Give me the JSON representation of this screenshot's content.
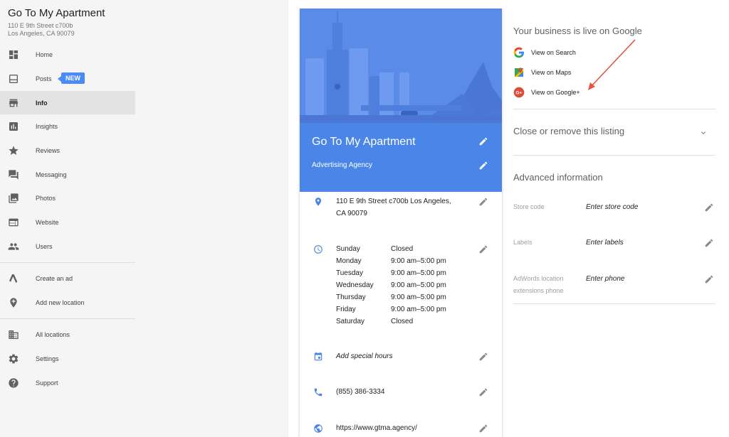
{
  "business": {
    "name": "Go To My Apartment",
    "address_line1": "110 E 9th Street c700b",
    "address_line2": "Los Angeles, CA 90079"
  },
  "sidebar": {
    "items": [
      {
        "label": "Home",
        "icon": "dashboard-icon"
      },
      {
        "label": "Posts",
        "icon": "posts-icon",
        "badge": "NEW"
      },
      {
        "label": "Info",
        "icon": "store-icon"
      },
      {
        "label": "Insights",
        "icon": "insights-icon"
      },
      {
        "label": "Reviews",
        "icon": "star-icon"
      },
      {
        "label": "Messaging",
        "icon": "chat-icon"
      },
      {
        "label": "Photos",
        "icon": "photo-icon"
      },
      {
        "label": "Website",
        "icon": "website-icon"
      },
      {
        "label": "Users",
        "icon": "users-icon"
      },
      {
        "label": "Create an ad",
        "icon": "adwords-icon"
      },
      {
        "label": "Add new location",
        "icon": "add-location-icon"
      },
      {
        "label": "All locations",
        "icon": "building-icon"
      },
      {
        "label": "Settings",
        "icon": "gear-icon"
      },
      {
        "label": "Support",
        "icon": "help-icon"
      }
    ]
  },
  "card": {
    "title": "Go To My Apartment",
    "category": "Advertising Agency",
    "address_line1": "110 E 9th Street c700b Los Angeles,",
    "address_line2": "CA 90079",
    "hours": [
      {
        "day": "Sunday",
        "time": "Closed"
      },
      {
        "day": "Monday",
        "time": "9:00 am–5:00 pm"
      },
      {
        "day": "Tuesday",
        "time": "9:00 am–5:00 pm"
      },
      {
        "day": "Wednesday",
        "time": "9:00 am–5:00 pm"
      },
      {
        "day": "Thursday",
        "time": "9:00 am–5:00 pm"
      },
      {
        "day": "Friday",
        "time": "9:00 am–5:00 pm"
      },
      {
        "day": "Saturday",
        "time": "Closed"
      }
    ],
    "special_hours": "Add special hours",
    "phone": "(855) 386-3334",
    "website": "https://www.gtma.agency/"
  },
  "live": {
    "title": "Your business is live on Google",
    "search": "View on Search",
    "maps": "View on Maps",
    "gplus": "View on Google+"
  },
  "close_listing": "Close or remove this listing",
  "advanced": {
    "title": "Advanced information",
    "store_code_label": "Store code",
    "store_code_value": "Enter store code",
    "labels_label": "Labels",
    "labels_value": "Enter labels",
    "adwords_label_line1": "AdWords location",
    "adwords_label_line2": "extensions phone",
    "adwords_value": "Enter phone"
  },
  "colors": {
    "accent": "#4a86e8",
    "badge": "#4a8af4",
    "arrow": "#e8533f"
  }
}
